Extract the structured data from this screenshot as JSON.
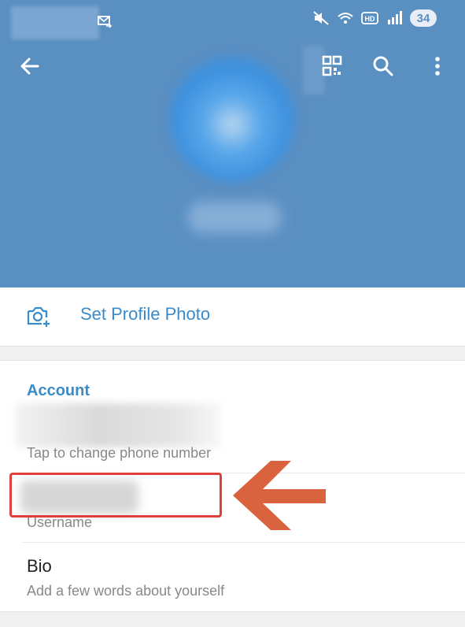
{
  "status_bar": {
    "battery": "34",
    "icons": [
      "message-icon",
      "mute-icon",
      "wifi-icon",
      "hd-icon",
      "signal-icon"
    ]
  },
  "toolbar": {
    "icons": [
      "back-arrow-icon",
      "qr-code-icon",
      "search-icon",
      "more-vertical-icon"
    ]
  },
  "profile": {
    "set_photo_label": "Set Profile Photo"
  },
  "account": {
    "title": "Account",
    "phone_hint": "Tap to change phone number",
    "username_hint": "Username",
    "bio_label": "Bio",
    "bio_hint": "Add a few words about yourself"
  },
  "colors": {
    "header": "#5a8fc2",
    "accent": "#3a8bc9",
    "highlight": "#e0403b",
    "arrow": "#d9633f"
  }
}
